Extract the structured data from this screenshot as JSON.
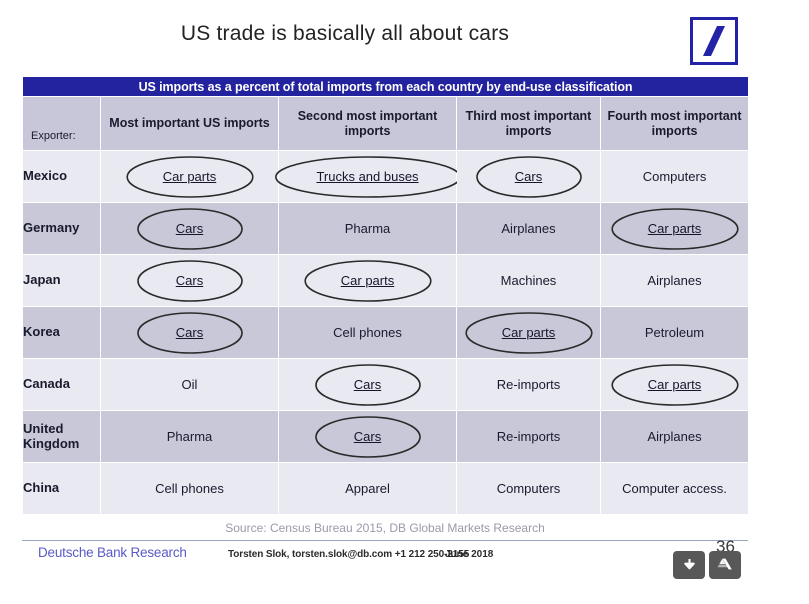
{
  "slide": {
    "title": "US trade is basically all about cars",
    "logo_name": "deutsche-bank-logo"
  },
  "table": {
    "band_title": "US imports as a percent of total imports from each country by end-use classification",
    "exporter_label": "Exporter:",
    "columns": [
      "Most important US imports",
      "Second most important imports",
      "Third most important imports",
      "Fourth most important imports"
    ],
    "rows": [
      {
        "country": "Mexico",
        "shade": "light",
        "cells": [
          {
            "text": "Car parts",
            "circled": true
          },
          {
            "text": "Trucks and buses",
            "circled": true
          },
          {
            "text": "Cars",
            "circled": true
          },
          {
            "text": "Computers",
            "circled": false
          }
        ]
      },
      {
        "country": "Germany",
        "shade": "dark",
        "cells": [
          {
            "text": "Cars",
            "circled": true
          },
          {
            "text": "Pharma",
            "circled": false
          },
          {
            "text": "Airplanes",
            "circled": false
          },
          {
            "text": "Car parts",
            "circled": true
          }
        ]
      },
      {
        "country": "Japan",
        "shade": "light",
        "cells": [
          {
            "text": "Cars",
            "circled": true
          },
          {
            "text": "Car parts",
            "circled": true
          },
          {
            "text": "Machines",
            "circled": false
          },
          {
            "text": "Airplanes",
            "circled": false
          }
        ]
      },
      {
        "country": "Korea",
        "shade": "dark",
        "cells": [
          {
            "text": "Cars",
            "circled": true
          },
          {
            "text": "Cell phones",
            "circled": false
          },
          {
            "text": "Car parts",
            "circled": true
          },
          {
            "text": "Petroleum",
            "circled": false
          }
        ]
      },
      {
        "country": "Canada",
        "shade": "light",
        "cells": [
          {
            "text": "Oil",
            "circled": false
          },
          {
            "text": "Cars",
            "circled": true
          },
          {
            "text": "Re-imports",
            "circled": false
          },
          {
            "text": "Car parts",
            "circled": true
          }
        ]
      },
      {
        "country": "United Kingdom",
        "shade": "dark",
        "cells": [
          {
            "text": "Pharma",
            "circled": false
          },
          {
            "text": "Cars",
            "circled": true
          },
          {
            "text": "Re-imports",
            "circled": false
          },
          {
            "text": "Airplanes",
            "circled": false
          }
        ]
      },
      {
        "country": "China",
        "shade": "light",
        "cells": [
          {
            "text": "Cell phones",
            "circled": false
          },
          {
            "text": "Apparel",
            "circled": false
          },
          {
            "text": "Computers",
            "circled": false
          },
          {
            "text": "Computer access.",
            "circled": false
          }
        ]
      }
    ]
  },
  "source": "Source: Census Bureau 2015, DB Global Markets Research",
  "footer": {
    "brand": "Deutsche Bank Research",
    "contact": "Torsten Slok, torsten.slok@db.com  +1 212 250-2155",
    "date": "June 2018",
    "page_number": "36"
  },
  "overlay": {
    "download_button": "download-icon",
    "drive_button": "google-drive-icon"
  },
  "colors": {
    "band": "#2323a0",
    "header_row": "#c7c7d9",
    "row_light": "#e9e9f1",
    "row_dark": "#c8c8d9",
    "brand_blue": "#5a5ac8",
    "logo_blue": "#2323a8",
    "source_gray": "#9a9aaa"
  }
}
